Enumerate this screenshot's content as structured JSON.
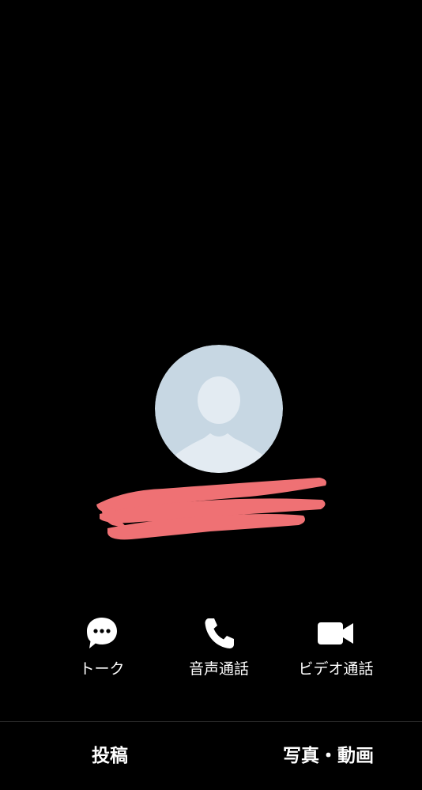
{
  "profile": {
    "avatar_icon": "default-person-avatar",
    "name_redacted": true
  },
  "actions": {
    "talk": {
      "label": "トーク",
      "icon": "chat-bubble-icon"
    },
    "voice_call": {
      "label": "音声通話",
      "icon": "phone-icon"
    },
    "video_call": {
      "label": "ビデオ通話",
      "icon": "video-camera-icon"
    }
  },
  "bottom_bar": {
    "post_label": "投稿",
    "media_label": "写真・動画"
  },
  "colors": {
    "background": "#000000",
    "avatar_bg": "#c7d7e3",
    "avatar_figure": "#e3ebf2",
    "redaction": "#ef7174",
    "icon": "#ffffff",
    "text": "#ffffff"
  }
}
